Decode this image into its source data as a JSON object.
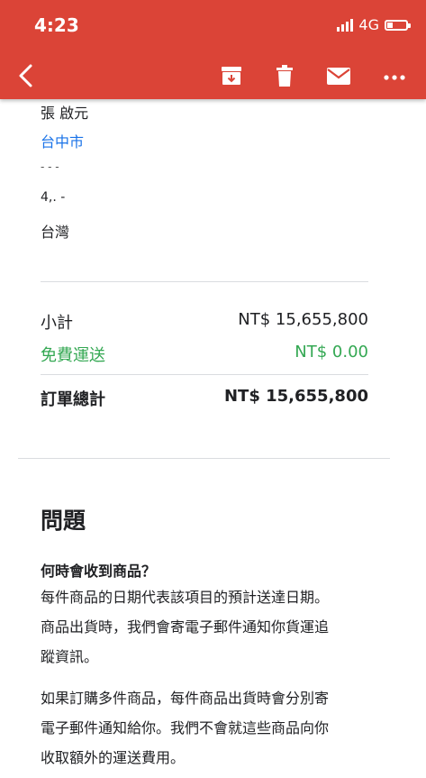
{
  "status_bar": {
    "time": "4:23",
    "network": "4G"
  },
  "toolbar": {
    "icons": [
      "back-arrow-icon",
      "archive-icon",
      "trash-icon",
      "mail-icon",
      "more-icon"
    ]
  },
  "address": {
    "name": "張 啟元",
    "city": "台中市",
    "line3": "- - -",
    "line4": "4,. -",
    "country": "台灣"
  },
  "summary": {
    "subtotal_label": "小計",
    "subtotal_value": "NT$ 15,655,800",
    "shipping_label": "免費運送",
    "shipping_value": "NT$ 0.00",
    "total_label": "訂單總計",
    "total_value": "NT$ 15,655,800"
  },
  "faq": {
    "title": "問題",
    "question": "何時會收到商品？",
    "answer1_l1": "每件商品的日期代表該項目的預計送達日期。",
    "answer1_l2": "商品出貨時，我們會寄電子郵件通知你貨運追",
    "answer1_l3": "蹤資訊。",
    "answer2_l1": "如果訂購多件商品，每件商品出貨時會分別寄",
    "answer2_l2": "電子郵件通知給你。我們不會就這些商品向你",
    "answer2_l3": "收取額外的運送費用。"
  },
  "colors": {
    "header": "#db4437",
    "link": "#1a73e8",
    "free": "#34a853"
  }
}
